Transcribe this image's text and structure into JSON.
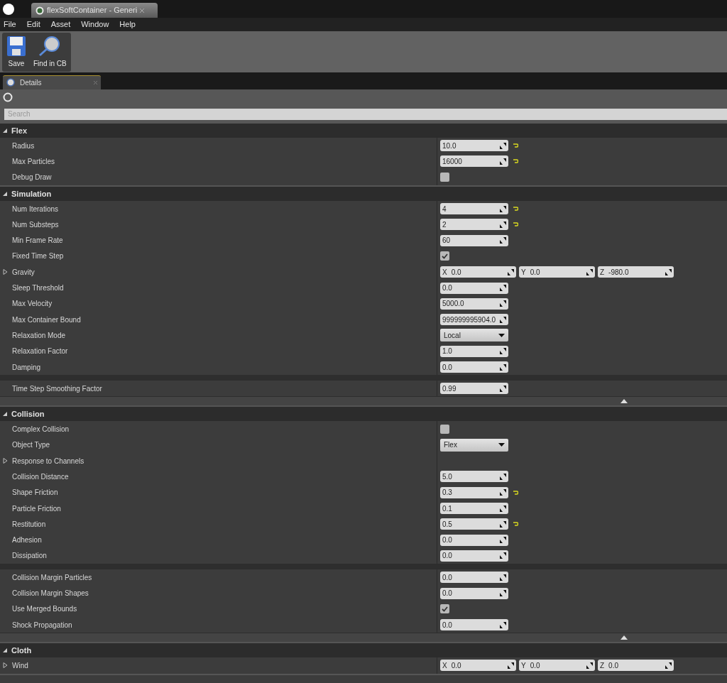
{
  "window": {
    "tab_title": "flexSoftContainer - Generi"
  },
  "menu": [
    "File",
    "Edit",
    "Asset",
    "Window",
    "Help"
  ],
  "toolbar": [
    {
      "kind": "save",
      "label": "Save"
    },
    {
      "kind": "find",
      "label": "Find in CB"
    }
  ],
  "panel_tab": {
    "label": "Details"
  },
  "search": {
    "placeholder": "Search"
  },
  "categories": [
    {
      "title": "Flex",
      "expanded": true,
      "advanced_toggle": false,
      "groups": [
        [
          {
            "label": "Radius",
            "kind": "number",
            "value": "10.0",
            "reset": true
          },
          {
            "label": "Max Particles",
            "kind": "number",
            "value": "16000",
            "reset": true
          },
          {
            "label": "Debug Draw",
            "kind": "checkbox",
            "checked": false
          }
        ]
      ]
    },
    {
      "title": "Simulation",
      "expanded": true,
      "advanced_toggle": true,
      "groups": [
        [
          {
            "label": "Num Iterations",
            "kind": "number",
            "value": "4",
            "reset": true
          },
          {
            "label": "Num Substeps",
            "kind": "number",
            "value": "2",
            "reset": true
          },
          {
            "label": "Min Frame Rate",
            "kind": "number",
            "value": "60",
            "reset": false
          },
          {
            "label": "Fixed Time Step",
            "kind": "checkbox",
            "checked": true
          },
          {
            "label": "Gravity",
            "kind": "vector",
            "expanded": false,
            "components": [
              {
                "axis": "X",
                "value": "0.0"
              },
              {
                "axis": "Y",
                "value": "0.0"
              },
              {
                "axis": "Z",
                "value": "-980.0"
              }
            ]
          },
          {
            "label": "Sleep Threshold",
            "kind": "number",
            "value": "0.0",
            "reset": false
          },
          {
            "label": "Max Velocity",
            "kind": "number",
            "value": "5000.0",
            "reset": false
          },
          {
            "label": "Max Container Bound",
            "kind": "number",
            "value": "999999995904.0",
            "reset": false
          },
          {
            "label": "Relaxation Mode",
            "kind": "dropdown",
            "value": "Local"
          },
          {
            "label": "Relaxation Factor",
            "kind": "number",
            "value": "1.0",
            "reset": false
          },
          {
            "label": "Damping",
            "kind": "number",
            "value": "0.0",
            "reset": false
          }
        ],
        [
          {
            "label": "Time Step Smoothing Factor",
            "kind": "number",
            "value": "0.99",
            "reset": false
          }
        ]
      ]
    },
    {
      "title": "Collision",
      "expanded": true,
      "advanced_toggle": true,
      "groups": [
        [
          {
            "label": "Complex Collision",
            "kind": "checkbox",
            "checked": false
          },
          {
            "label": "Object Type",
            "kind": "dropdown",
            "value": "Flex"
          },
          {
            "label": "Response to Channels",
            "kind": "group",
            "expanded": false
          },
          {
            "label": "Collision Distance",
            "kind": "number",
            "value": "5.0",
            "reset": false
          },
          {
            "label": "Shape Friction",
            "kind": "number",
            "value": "0.3",
            "reset": true
          },
          {
            "label": "Particle Friction",
            "kind": "number",
            "value": "0.1",
            "reset": false
          },
          {
            "label": "Restitution",
            "kind": "number",
            "value": "0.5",
            "reset": true
          },
          {
            "label": "Adhesion",
            "kind": "number",
            "value": "0.0",
            "reset": false
          },
          {
            "label": "Dissipation",
            "kind": "number",
            "value": "0.0",
            "reset": false
          }
        ],
        [
          {
            "label": "Collision Margin Particles",
            "kind": "number",
            "value": "0.0",
            "reset": false
          },
          {
            "label": "Collision Margin Shapes",
            "kind": "number",
            "value": "0.0",
            "reset": false
          },
          {
            "label": "Use Merged Bounds",
            "kind": "checkbox",
            "checked": true
          },
          {
            "label": "Shock Propagation",
            "kind": "number",
            "value": "0.0",
            "reset": false
          }
        ]
      ]
    },
    {
      "title": "Cloth",
      "expanded": true,
      "advanced_toggle": false,
      "groups": [
        [
          {
            "label": "Wind",
            "kind": "vector",
            "expanded": false,
            "components": [
              {
                "axis": "X",
                "value": "0.0"
              },
              {
                "axis": "Y",
                "value": "0.0"
              },
              {
                "axis": "Z",
                "value": "0.0"
              }
            ]
          }
        ]
      ]
    }
  ]
}
